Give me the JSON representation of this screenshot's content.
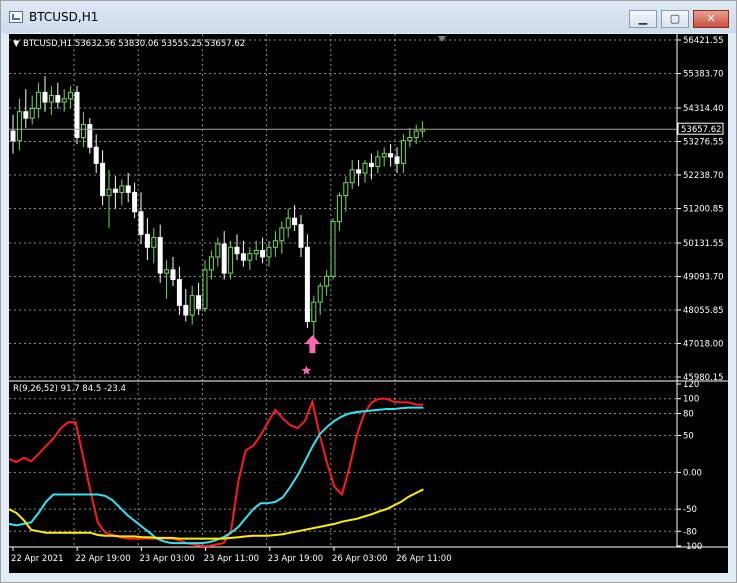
{
  "window": {
    "title": "BTCUSD,H1",
    "buttons": {
      "minimize": "▁",
      "maximize": "▢",
      "close": "✕"
    }
  },
  "price_panel": {
    "header": "BTCUSD,H1  53632.56 53830.06 53555.25 53657.62",
    "current_price_label": "53657.62"
  },
  "indicator_panel": {
    "header": "R(9,26,52) 91.7 84.5 -23.4"
  },
  "colors": {
    "background": "#000000",
    "grid": "#ffffff",
    "bull_candle": "#6fdc57",
    "bear_candle": "#ffffff",
    "arrow": "#ff69b4",
    "line_fast": "#ff1b1b",
    "line_mid": "#2ee6f2",
    "line_slow": "#ffee00"
  },
  "icons": [
    "window-app-icon",
    "minimize-icon",
    "maximize-icon",
    "close-icon",
    "buy-arrow-icon",
    "star-icon",
    "dropdown-triangle-icon"
  ],
  "chart_data": [
    {
      "type": "candlestick",
      "symbol": "BTCUSD",
      "timeframe": "H1",
      "ylim": [
        45980.15,
        56421.55
      ],
      "yticks": [
        "56421.55",
        "55383.70",
        "54314.40",
        "53276.55",
        "52238.70",
        "51200.85",
        "50131.55",
        "49093.70",
        "48055.85",
        "47018.00",
        "45980.15"
      ],
      "xticks": [
        "22 Apr 2021",
        "22 Apr 19:00",
        "23 Apr 03:00",
        "23 Apr 11:00",
        "23 Apr 19:00",
        "26 Apr 03:00",
        "26 Apr 11:00"
      ],
      "last_price": 53657.62,
      "ohlc": [
        {
          "o": 53600,
          "h": 54100,
          "l": 52900,
          "c": 53300
        },
        {
          "o": 53300,
          "h": 54600,
          "l": 53000,
          "c": 54200
        },
        {
          "o": 54200,
          "h": 54900,
          "l": 53700,
          "c": 54000
        },
        {
          "o": 54000,
          "h": 54700,
          "l": 53800,
          "c": 54300
        },
        {
          "o": 54300,
          "h": 55100,
          "l": 54000,
          "c": 54800
        },
        {
          "o": 54800,
          "h": 55300,
          "l": 54200,
          "c": 54500
        },
        {
          "o": 54500,
          "h": 55000,
          "l": 54100,
          "c": 54700
        },
        {
          "o": 54700,
          "h": 55100,
          "l": 54300,
          "c": 54500
        },
        {
          "o": 54500,
          "h": 54900,
          "l": 54200,
          "c": 54600
        },
        {
          "o": 54600,
          "h": 55000,
          "l": 54300,
          "c": 54800
        },
        {
          "o": 54800,
          "h": 55000,
          "l": 53200,
          "c": 53400
        },
        {
          "o": 53400,
          "h": 54200,
          "l": 53100,
          "c": 53800
        },
        {
          "o": 53800,
          "h": 54000,
          "l": 52900,
          "c": 53100
        },
        {
          "o": 53100,
          "h": 53500,
          "l": 52300,
          "c": 52600
        },
        {
          "o": 52600,
          "h": 53000,
          "l": 51300,
          "c": 51600
        },
        {
          "o": 51600,
          "h": 52400,
          "l": 50600,
          "c": 51800
        },
        {
          "o": 51800,
          "h": 52200,
          "l": 51200,
          "c": 51700
        },
        {
          "o": 51700,
          "h": 52100,
          "l": 51300,
          "c": 51900
        },
        {
          "o": 51900,
          "h": 52300,
          "l": 51400,
          "c": 51700
        },
        {
          "o": 51700,
          "h": 52000,
          "l": 50900,
          "c": 51100
        },
        {
          "o": 51100,
          "h": 51700,
          "l": 50100,
          "c": 50400
        },
        {
          "o": 50400,
          "h": 50900,
          "l": 49600,
          "c": 50000
        },
        {
          "o": 50000,
          "h": 50600,
          "l": 49500,
          "c": 50300
        },
        {
          "o": 50300,
          "h": 50700,
          "l": 48900,
          "c": 49200
        },
        {
          "o": 49200,
          "h": 49600,
          "l": 48400,
          "c": 49300
        },
        {
          "o": 49300,
          "h": 49700,
          "l": 48800,
          "c": 49000
        },
        {
          "o": 49000,
          "h": 49400,
          "l": 47900,
          "c": 48200
        },
        {
          "o": 48200,
          "h": 48700,
          "l": 47700,
          "c": 47900
        },
        {
          "o": 47900,
          "h": 48800,
          "l": 47600,
          "c": 48500
        },
        {
          "o": 48500,
          "h": 48900,
          "l": 47900,
          "c": 48100
        },
        {
          "o": 48100,
          "h": 49600,
          "l": 48000,
          "c": 49300
        },
        {
          "o": 49300,
          "h": 49900,
          "l": 49000,
          "c": 49700
        },
        {
          "o": 49700,
          "h": 50300,
          "l": 49400,
          "c": 50100
        },
        {
          "o": 50100,
          "h": 50500,
          "l": 49000,
          "c": 49200
        },
        {
          "o": 49200,
          "h": 50200,
          "l": 49000,
          "c": 50000
        },
        {
          "o": 50000,
          "h": 50400,
          "l": 49600,
          "c": 49800
        },
        {
          "o": 49800,
          "h": 50200,
          "l": 49400,
          "c": 49600
        },
        {
          "o": 49600,
          "h": 50000,
          "l": 49300,
          "c": 49800
        },
        {
          "o": 49800,
          "h": 50200,
          "l": 49600,
          "c": 49900
        },
        {
          "o": 49900,
          "h": 50300,
          "l": 49500,
          "c": 49700
        },
        {
          "o": 49700,
          "h": 50200,
          "l": 49400,
          "c": 50000
        },
        {
          "o": 50000,
          "h": 50500,
          "l": 49700,
          "c": 50200
        },
        {
          "o": 50200,
          "h": 50800,
          "l": 49800,
          "c": 50600
        },
        {
          "o": 50600,
          "h": 51200,
          "l": 50300,
          "c": 50900
        },
        {
          "o": 50900,
          "h": 51300,
          "l": 50500,
          "c": 50700
        },
        {
          "o": 50700,
          "h": 51000,
          "l": 49700,
          "c": 50000
        },
        {
          "o": 50000,
          "h": 50400,
          "l": 47500,
          "c": 47700
        },
        {
          "o": 47700,
          "h": 48500,
          "l": 47200,
          "c": 48300
        },
        {
          "o": 48300,
          "h": 48900,
          "l": 47900,
          "c": 48800
        },
        {
          "o": 48800,
          "h": 49300,
          "l": 48500,
          "c": 49100
        },
        {
          "o": 49100,
          "h": 50900,
          "l": 49000,
          "c": 50800
        },
        {
          "o": 50800,
          "h": 51700,
          "l": 50500,
          "c": 51600
        },
        {
          "o": 51600,
          "h": 52200,
          "l": 51100,
          "c": 52000
        },
        {
          "o": 52000,
          "h": 52700,
          "l": 51800,
          "c": 52400
        },
        {
          "o": 52400,
          "h": 52700,
          "l": 51900,
          "c": 52300
        },
        {
          "o": 52300,
          "h": 52700,
          "l": 52000,
          "c": 52600
        },
        {
          "o": 52600,
          "h": 52900,
          "l": 52100,
          "c": 52500
        },
        {
          "o": 52500,
          "h": 53000,
          "l": 52300,
          "c": 52800
        },
        {
          "o": 52800,
          "h": 53100,
          "l": 52500,
          "c": 52900
        },
        {
          "o": 52900,
          "h": 53200,
          "l": 52500,
          "c": 52800
        },
        {
          "o": 52800,
          "h": 53100,
          "l": 52300,
          "c": 52600
        },
        {
          "o": 52600,
          "h": 53500,
          "l": 52300,
          "c": 53300
        },
        {
          "o": 53300,
          "h": 53700,
          "l": 53100,
          "c": 53400
        },
        {
          "o": 53400,
          "h": 53800,
          "l": 53200,
          "c": 53600
        },
        {
          "o": 53600,
          "h": 53900,
          "l": 53400,
          "c": 53657.62
        }
      ],
      "markers": [
        {
          "type": "buy-arrow",
          "bar": 46,
          "price": 47000
        },
        {
          "type": "star",
          "bar": 46,
          "price": 46180
        }
      ]
    },
    {
      "type": "line",
      "name": "R(9,26,52)",
      "ylim": [
        -100,
        120
      ],
      "yticks": [
        "120",
        "100",
        "80",
        "50",
        "0.00",
        "-50",
        "-80",
        "-100"
      ],
      "series": [
        {
          "name": "fast",
          "color": "#ff1b1b",
          "values": [
            18,
            14,
            20,
            15,
            25,
            36,
            46,
            60,
            68,
            68,
            22,
            -25,
            -68,
            -82,
            -85,
            -88,
            -90,
            -90,
            -90,
            -90,
            -90,
            -90,
            -90,
            -92,
            -96,
            -98,
            -100,
            -100,
            -98,
            -96,
            -80,
            -12,
            30,
            36,
            50,
            68,
            85,
            73,
            64,
            60,
            70,
            96,
            50,
            12,
            -20,
            -30,
            6,
            50,
            80,
            95,
            100,
            100,
            96,
            95,
            95,
            92,
            92
          ]
        },
        {
          "name": "mid",
          "color": "#2ee6f2",
          "values": [
            -70,
            -72,
            -70,
            -68,
            -55,
            -40,
            -30,
            -30,
            -30,
            -30,
            -30,
            -30,
            -30,
            -32,
            -38,
            -48,
            -58,
            -66,
            -74,
            -82,
            -90,
            -94,
            -96,
            -96,
            -96,
            -96,
            -96,
            -95,
            -92,
            -88,
            -82,
            -74,
            -62,
            -50,
            -42,
            -42,
            -40,
            -34,
            -20,
            -4,
            15,
            35,
            52,
            62,
            70,
            76,
            80,
            82,
            83,
            84,
            85,
            86,
            86,
            87,
            88,
            88,
            88
          ]
        },
        {
          "name": "slow",
          "color": "#ffee00",
          "values": [
            -50,
            -55,
            -65,
            -78,
            -80,
            -82,
            -82,
            -82,
            -82,
            -82,
            -82,
            -82,
            -85,
            -86,
            -86,
            -87,
            -87,
            -87,
            -88,
            -88,
            -89,
            -89,
            -89,
            -90,
            -90,
            -90,
            -90,
            -90,
            -90,
            -90,
            -89,
            -88,
            -87,
            -86,
            -86,
            -86,
            -85,
            -84,
            -82,
            -80,
            -78,
            -76,
            -74,
            -72,
            -70,
            -67,
            -65,
            -63,
            -60,
            -57,
            -53,
            -50,
            -45,
            -40,
            -33,
            -28,
            -23
          ]
        }
      ]
    }
  ]
}
